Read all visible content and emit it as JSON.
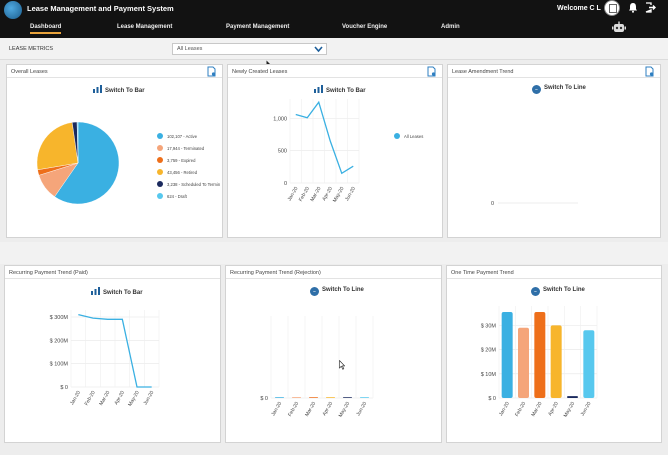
{
  "header": {
    "app_title": "Lease Management and Payment System",
    "nav": [
      {
        "label": "Dashboard",
        "active": true
      },
      {
        "label": "Lease Management"
      },
      {
        "label": "Payment Management"
      },
      {
        "label": "Voucher Engine"
      },
      {
        "label": "Admin"
      }
    ],
    "welcome": "Welcome  C L",
    "accent": "#e8a33c"
  },
  "metrics": {
    "label": "LEASE METRICS",
    "filter_value": "All Leases"
  },
  "panels": {
    "overall": {
      "title": "Overall Leases",
      "switch_label": "Switch To Bar",
      "legend": [
        {
          "label": "102,107 - Active",
          "color": "#3ab0e2"
        },
        {
          "label": "17,944 - Terminated",
          "color": "#f5a57a"
        },
        {
          "label": "3,759 - Expired",
          "color": "#ee6f1a"
        },
        {
          "label": "43,456 - Retired",
          "color": "#f7b52c"
        },
        {
          "label": "3,238 - Scheduled To Termin",
          "color": "#1b2a5e"
        },
        {
          "label": "624 - Draft",
          "color": "#57c8ee"
        }
      ]
    },
    "newly": {
      "title": "Newly Created Leases",
      "switch_label": "Switch To Bar",
      "legend_label": "All Leases"
    },
    "amend": {
      "title": "Lease Amendment Trend",
      "switch_label": "Switch To Line"
    },
    "recurring_paid": {
      "title": "Recurring Payment Trend (Paid)",
      "switch_label": "Switch To Bar"
    },
    "recurring_rej": {
      "title": "Recurring Payment Trend (Rejection)",
      "switch_label": "Switch To Line"
    },
    "onetime": {
      "title": "One Time Payment Trend",
      "switch_label": "Switch To Line"
    }
  },
  "chart_data": [
    {
      "type": "pie",
      "labels": [
        "Active",
        "Terminated",
        "Expired",
        "Retired",
        "Scheduled To Termin",
        "Draft"
      ],
      "values": [
        102107,
        17944,
        3759,
        43456,
        3238,
        624
      ],
      "colors": [
        "#3ab0e2",
        "#f5a57a",
        "#ee6f1a",
        "#f7b52c",
        "#1b2a5e",
        "#57c8ee"
      ]
    },
    {
      "type": "line",
      "categories": [
        "Jan-20",
        "Feb-20",
        "Mar-20",
        "Apr-20",
        "May-20",
        "Jun-20"
      ],
      "series": [
        {
          "name": "All Leases",
          "values": [
            1060,
            1010,
            1250,
            650,
            150,
            260
          ],
          "color": "#3ab0e2"
        }
      ],
      "ylim": [
        0,
        1300
      ],
      "yticks": [
        {
          "v": 0,
          "label": "0"
        },
        {
          "v": 500,
          "label": "500"
        },
        {
          "v": 1000,
          "label": "1,000"
        }
      ]
    },
    {
      "type": "line",
      "categories": [],
      "series": [],
      "ylim": [
        0,
        1
      ],
      "yticks": [
        {
          "v": 0,
          "label": "0"
        }
      ]
    },
    {
      "type": "line",
      "categories": [
        "Jan-20",
        "Feb-20",
        "Mar-20",
        "Apr-20",
        "May-20",
        "Jun-20"
      ],
      "series": [
        {
          "values": [
            310,
            295,
            290,
            290,
            0,
            0
          ],
          "color": "#3ab0e2"
        }
      ],
      "ylim": [
        0,
        330
      ],
      "yticks": [
        {
          "v": 0,
          "label": "$ 0"
        },
        {
          "v": 100,
          "label": "$ 100M"
        },
        {
          "v": 200,
          "label": "$ 200M"
        },
        {
          "v": 300,
          "label": "$ 300M"
        }
      ]
    },
    {
      "type": "bar",
      "categories": [
        "Jan-20",
        "Feb-20",
        "Mar-20",
        "Apr-20",
        "May-20",
        "Jun-20"
      ],
      "values": [
        0,
        0,
        0,
        0,
        0,
        0
      ],
      "colors": [
        "#3ab0e2",
        "#f5a57a",
        "#ee6f1a",
        "#f7b52c",
        "#1b2a5e",
        "#57c8ee"
      ],
      "ylim": [
        0,
        100
      ],
      "yticks": [
        {
          "v": 0,
          "label": "$ 0"
        }
      ]
    },
    {
      "type": "bar",
      "categories": [
        "Jan-20",
        "Feb-20",
        "Mar-20",
        "Apr-20",
        "May-20",
        "Jun-20"
      ],
      "values": [
        355,
        290,
        355,
        300,
        8,
        280
      ],
      "colors": [
        "#3ab0e2",
        "#f5a57a",
        "#ee6f1a",
        "#f7b52c",
        "#1b2a5e",
        "#57c8ee"
      ],
      "ylim": [
        0,
        380
      ],
      "yticks": [
        {
          "v": 0,
          "label": "$ 0"
        },
        {
          "v": 100,
          "label": "$ 10M"
        },
        {
          "v": 200,
          "label": "$ 20M"
        },
        {
          "v": 300,
          "label": "$ 30M"
        }
      ]
    }
  ]
}
